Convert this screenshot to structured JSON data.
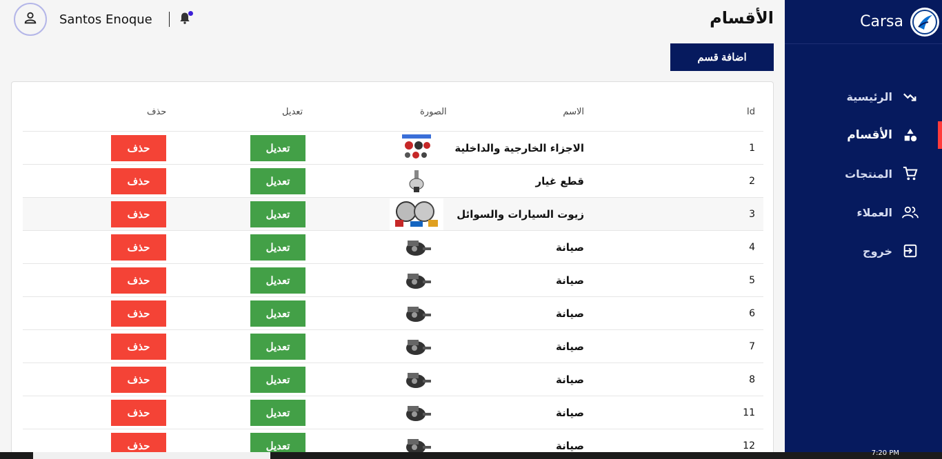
{
  "app": {
    "brand_name": "Carsa"
  },
  "header": {
    "page_title": "الأقسام",
    "user_name": "Santos Enoque"
  },
  "sidebar": {
    "items": [
      {
        "label": "الرئيسية",
        "icon": "trending-icon"
      },
      {
        "label": "الأقسام",
        "icon": "categories-icon",
        "active": true
      },
      {
        "label": "المنتجات",
        "icon": "cart-icon"
      },
      {
        "label": "العملاء",
        "icon": "people-icon"
      },
      {
        "label": "خروج",
        "icon": "logout-icon"
      }
    ]
  },
  "actions": {
    "add_category": "اضافة قسم"
  },
  "table": {
    "headers": {
      "id": "Id",
      "name": "الاسم",
      "image": "الصورة",
      "edit": "تعديل",
      "delete": "حذف"
    },
    "edit_label": "تعديل",
    "delete_label": "حذف",
    "rows": [
      {
        "id": "1",
        "name": "الاجزاء الخارجية والداخلية",
        "image": "parts-thumbnail"
      },
      {
        "id": "2",
        "name": "قطع غيار",
        "image": "spare-part-thumbnail"
      },
      {
        "id": "3",
        "name": "زيوت السيارات والسوائل",
        "image": "oils-thumbnail"
      },
      {
        "id": "4",
        "name": "صيانة",
        "image": "maintenance-thumbnail"
      },
      {
        "id": "5",
        "name": "صيانة",
        "image": "maintenance-thumbnail"
      },
      {
        "id": "6",
        "name": "صيانة",
        "image": "maintenance-thumbnail"
      },
      {
        "id": "7",
        "name": "صيانة",
        "image": "maintenance-thumbnail"
      },
      {
        "id": "8",
        "name": "صيانة",
        "image": "maintenance-thumbnail"
      },
      {
        "id": "11",
        "name": "صيانة",
        "image": "maintenance-thumbnail"
      },
      {
        "id": "12",
        "name": "صيانة",
        "image": "maintenance-thumbnail"
      }
    ]
  },
  "taskbar": {
    "time": "7:20 PM"
  },
  "colors": {
    "sidebar": "#061a5e",
    "edit": "#43a047",
    "delete": "#f44336",
    "active_indicator": "#ff3b3b"
  }
}
